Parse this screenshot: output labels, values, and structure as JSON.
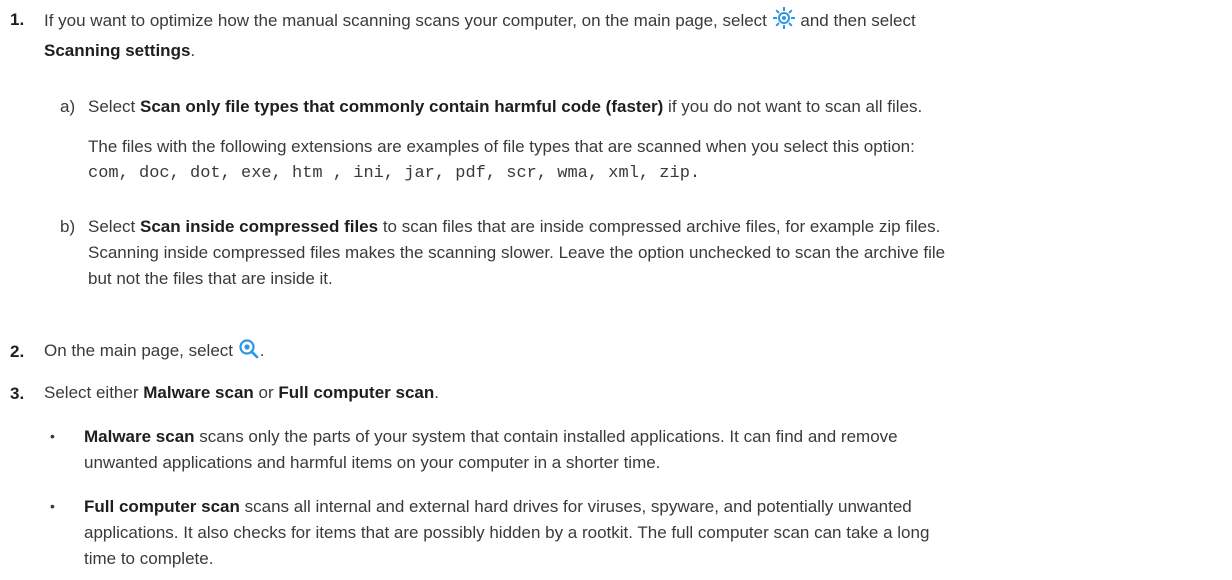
{
  "step1": {
    "number": "1.",
    "line1_pre": "If you want to optimize how the manual scanning scans your computer, on the main page, select",
    "line1_post": "and then select",
    "line2_bold": "Scanning settings",
    "line2_end": ".",
    "gear_icon": "settings-gear",
    "a": {
      "letter": "a)",
      "pre": "Select",
      "bold": "Scan only file types that commonly contain harmful code (faster)",
      "post": "if you do not want to scan all files.",
      "desc": "The files with the following extensions are examples of file types that are scanned when you select this option:",
      "extensions": "com, doc, dot, exe, htm , ini, jar, pdf, scr, wma, xml, zip."
    },
    "b": {
      "letter": "b)",
      "pre": "Select",
      "bold": "Scan inside compressed files",
      "line1_post": "to scan files that are inside compressed archive files, for example zip files.",
      "line2": "Scanning inside compressed files makes the scanning slower. Leave the option unchecked to scan the archive file",
      "line3": "but not the files that are inside it."
    }
  },
  "step2": {
    "number": "2.",
    "pre": "On the main page, select",
    "post": ".",
    "scan_icon": "scan-magnifier"
  },
  "step3": {
    "number": "3.",
    "pre": "Select either",
    "bold1": "Malware scan",
    "mid": "or",
    "bold2": "Full computer scan",
    "end": ".",
    "bullets": [
      {
        "bold": "Malware scan",
        "line1": "scans only the parts of your system that contain installed applications. It can find and remove",
        "line2": "unwanted applications and harmful items on your computer in a shorter time."
      },
      {
        "bold": "Full computer scan",
        "line1": "scans all internal and external hard drives for viruses, spyware, and potentially unwanted",
        "line2": "applications. It also checks for items that are possibly hidden by a rootkit. The full computer scan can take a long",
        "line3": "time to complete."
      }
    ]
  },
  "colors": {
    "accent": "#2a96e6",
    "text": "#3a3a3a",
    "bold": "#1e1e1e"
  }
}
